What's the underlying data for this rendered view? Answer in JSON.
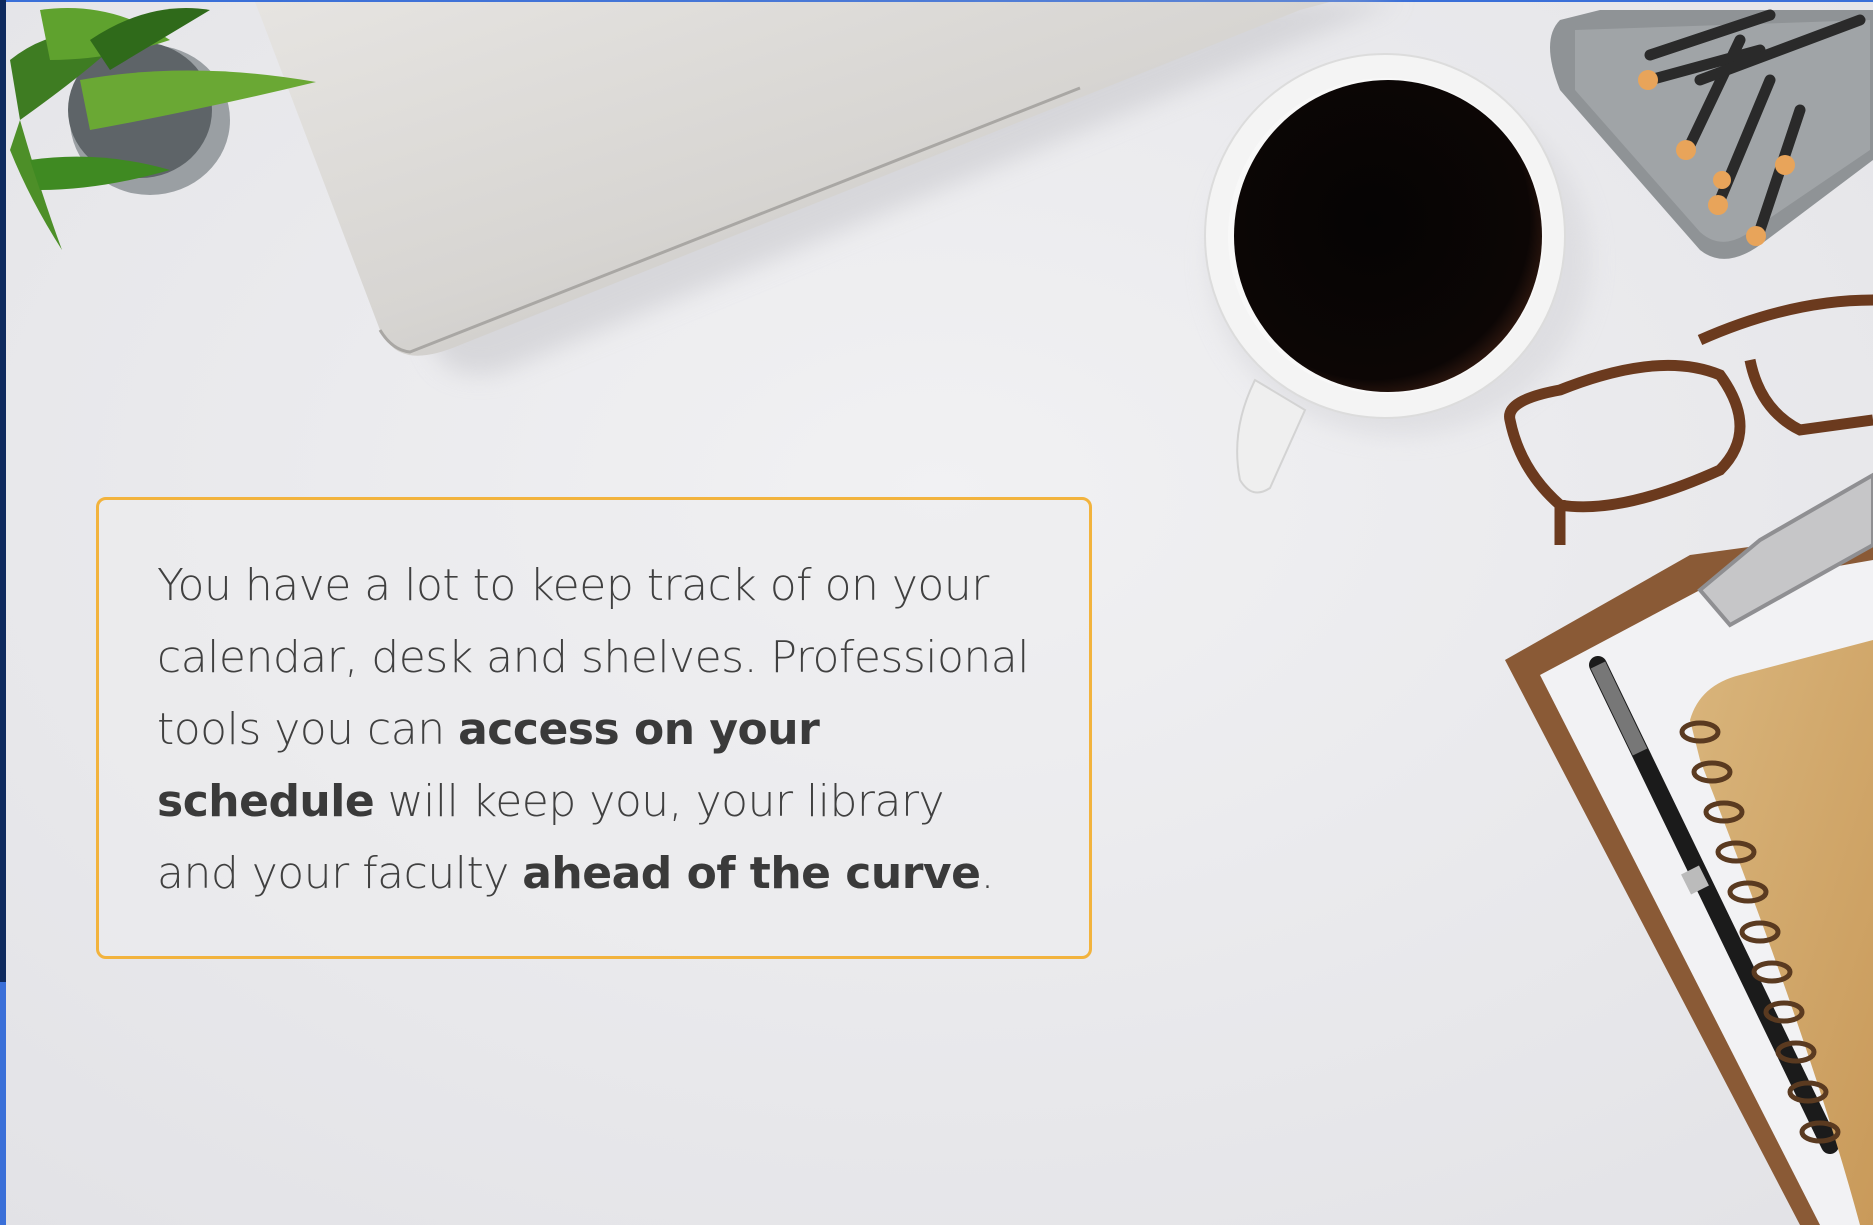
{
  "message": {
    "part1": "You have a lot to keep track of on your calendar, desk and shelves. Professional tools you can ",
    "bold1": "access on your schedule",
    "part2": " will keep you, your library and your faculty ",
    "bold2": "ahead of the curve",
    "part3": "."
  },
  "colors": {
    "card_border": "#f2b33d",
    "text": "#404040",
    "background": "#e9e9ec",
    "edge_accent": "#3a6fd8",
    "edge_dark": "#0e2a5e"
  },
  "background_image": {
    "objects": [
      "potted-plant",
      "laptop",
      "coffee-cup",
      "pencil-holder",
      "eyeglasses",
      "clipboard",
      "pen",
      "spiral-notebook"
    ]
  }
}
